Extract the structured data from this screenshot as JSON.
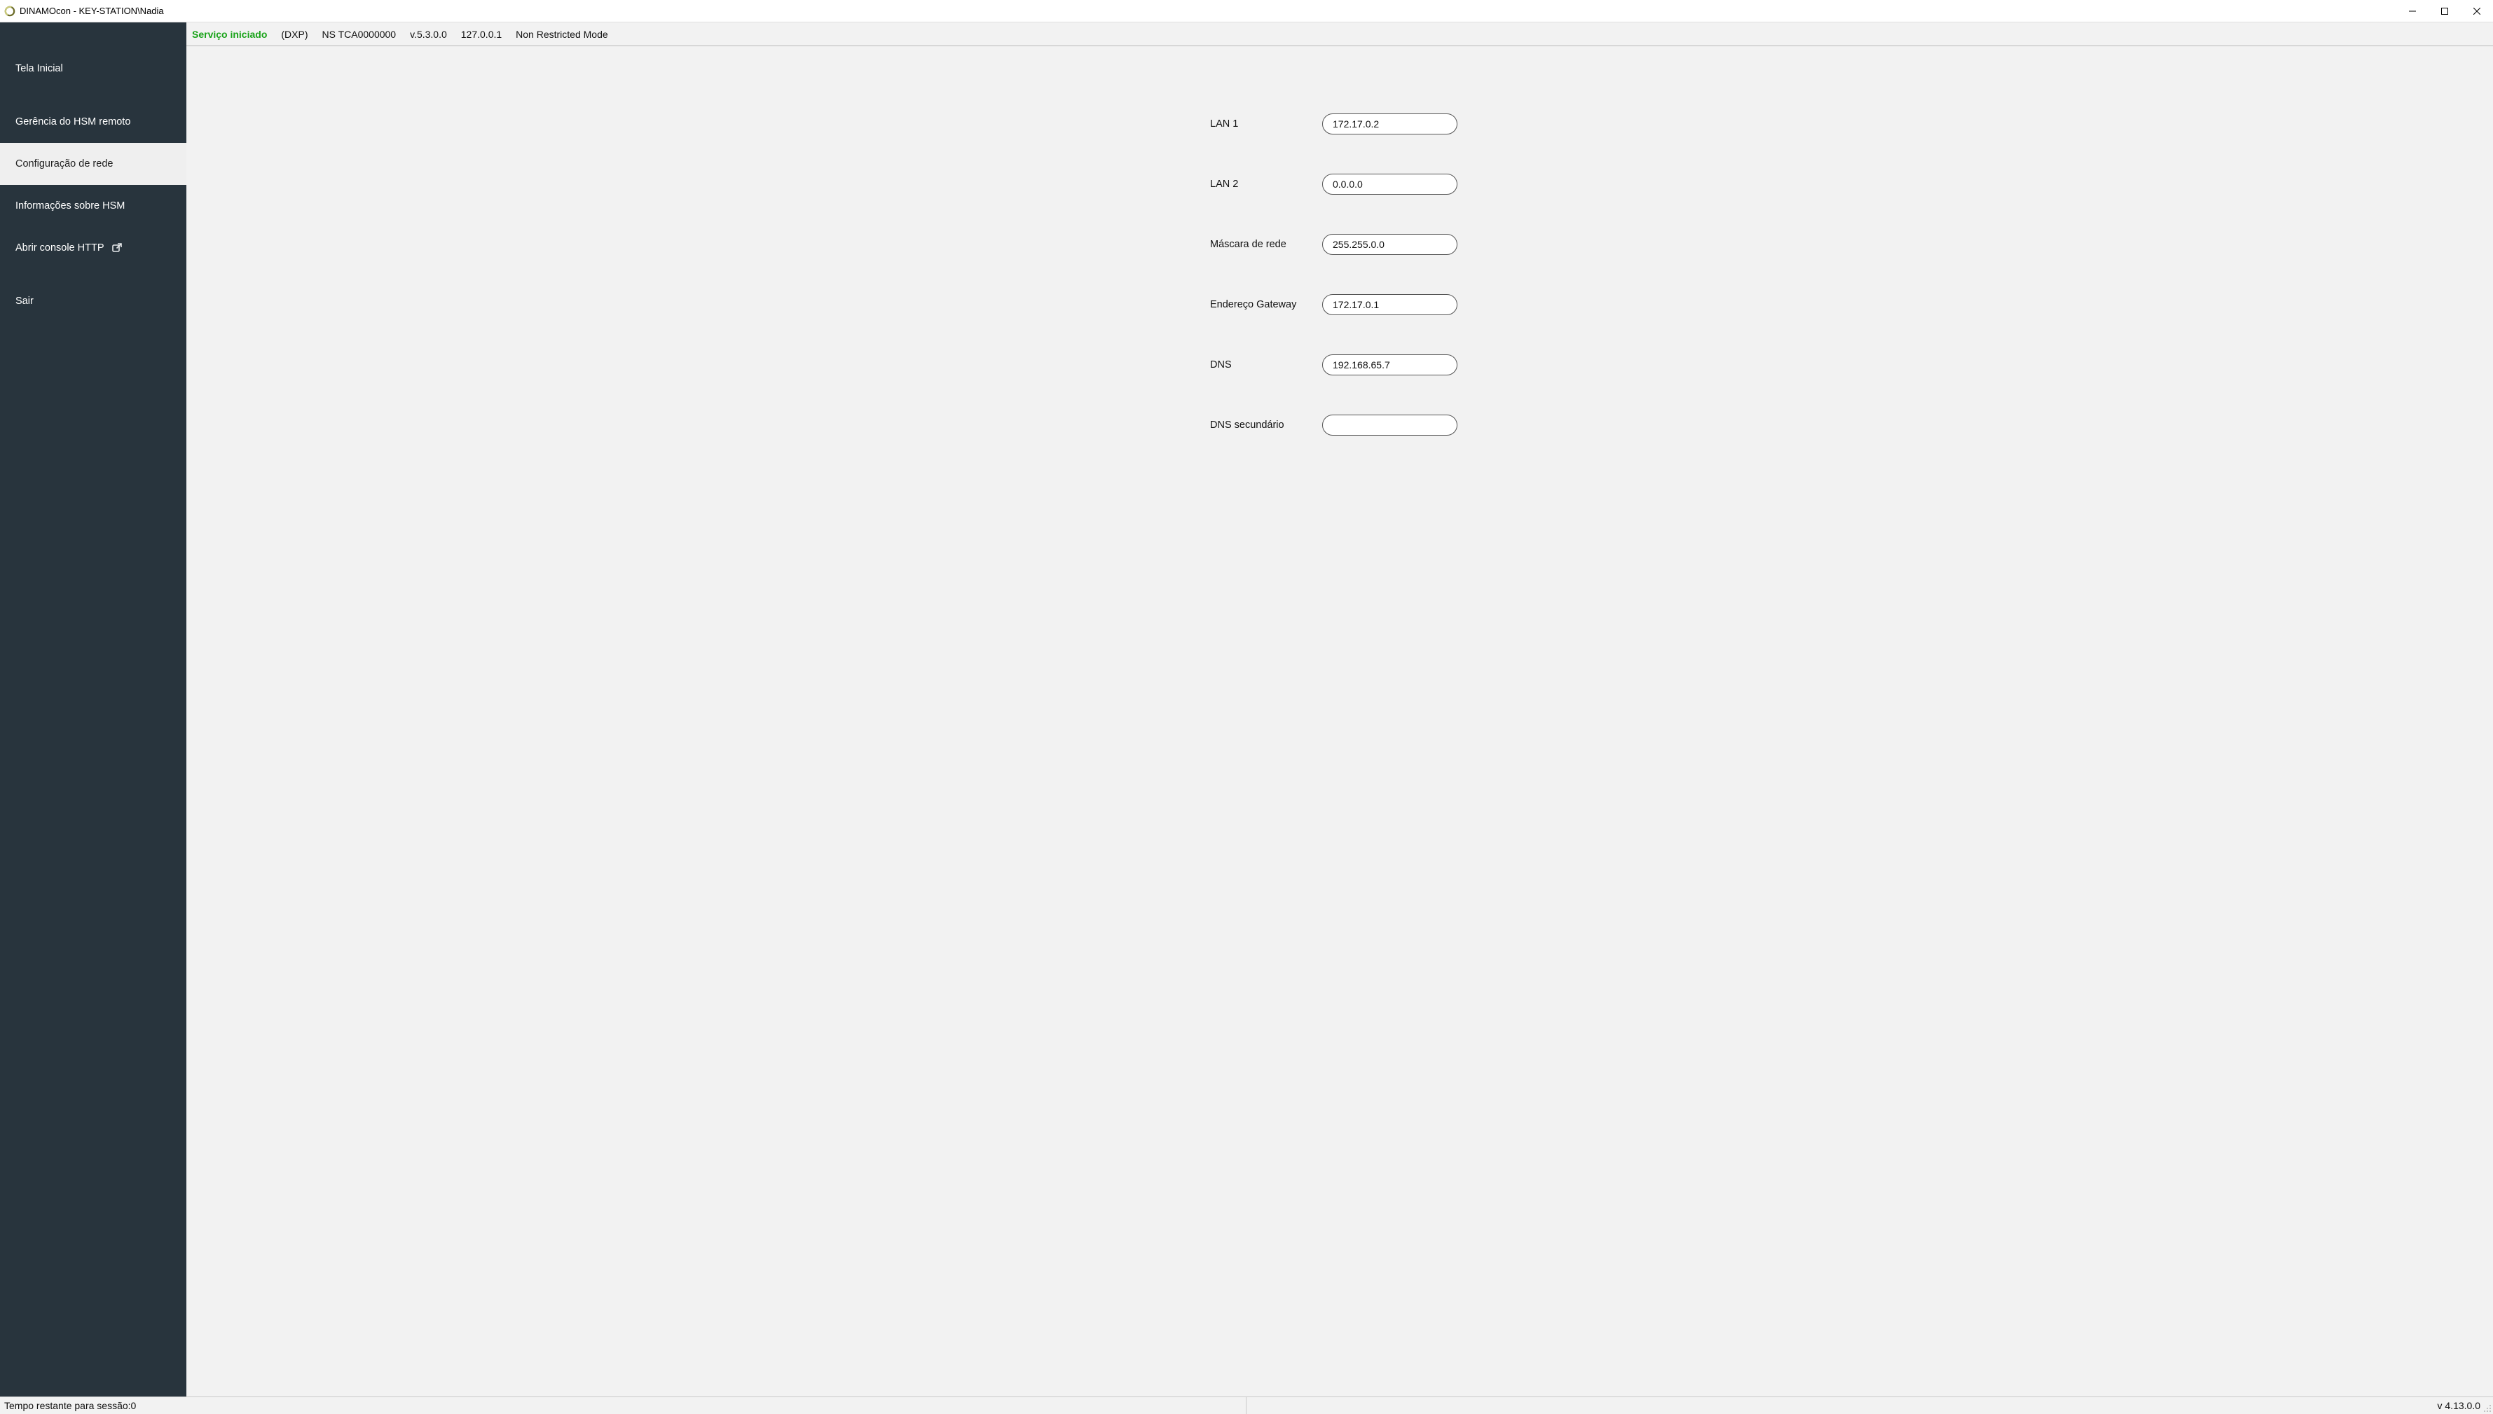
{
  "window": {
    "title": "DINAMOcon - KEY-STATION\\Nadia"
  },
  "sidebar": {
    "items": [
      {
        "label": "Tela Inicial"
      },
      {
        "label": "Gerência do HSM remoto"
      },
      {
        "label": "Configuração de rede"
      },
      {
        "label": "Informações sobre HSM"
      },
      {
        "label": "Abrir console HTTP"
      },
      {
        "label": "Sair"
      }
    ]
  },
  "topstrip": {
    "status": "Serviço iniciado",
    "platform": "(DXP)",
    "serial": "NS TCA0000000",
    "version": "v.5.3.0.0",
    "ip": "127.0.0.1",
    "mode": "Non Restricted Mode"
  },
  "form": {
    "lan1": {
      "label": "LAN 1",
      "value": "172.17.0.2"
    },
    "lan2": {
      "label": "LAN 2",
      "value": "0.0.0.0"
    },
    "mask": {
      "label": "Máscara de rede",
      "value": "255.255.0.0"
    },
    "gateway": {
      "label": "Endereço Gateway",
      "value": "172.17.0.1"
    },
    "dns": {
      "label": "DNS",
      "value": "192.168.65.7"
    },
    "dns2": {
      "label": "DNS secundário",
      "value": ""
    }
  },
  "statusbar": {
    "session_label": "Tempo restante para sessão: ",
    "session_value": "0",
    "version": "v 4.13.0.0"
  }
}
